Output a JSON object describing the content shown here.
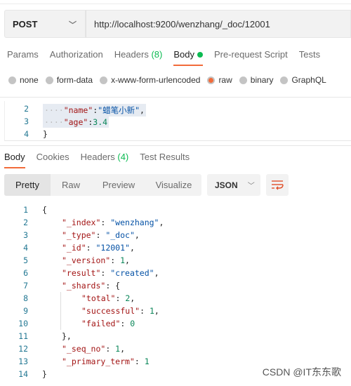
{
  "request": {
    "method": "POST",
    "url": "http://localhost:9200/wenzhang/_doc/12001"
  },
  "req_tabs": [
    {
      "label": "Params"
    },
    {
      "label": "Authorization"
    },
    {
      "label": "Headers",
      "count": "(8)"
    },
    {
      "label": "Body",
      "active": true
    },
    {
      "label": "Pre-request Script"
    },
    {
      "label": "Tests"
    }
  ],
  "body_types": [
    {
      "label": "none"
    },
    {
      "label": "form-data"
    },
    {
      "label": "x-www-form-urlencoded"
    },
    {
      "label": "raw",
      "selected": true
    },
    {
      "label": "binary"
    },
    {
      "label": "GraphQL"
    }
  ],
  "request_body_lines": [
    {
      "n": "2",
      "tokens": [
        [
          "ws",
          "····"
        ],
        [
          "k",
          "\"name\""
        ],
        [
          "p",
          ":"
        ],
        [
          "s",
          "\"蜡笔小新\""
        ],
        [
          "p",
          ","
        ]
      ]
    },
    {
      "n": "3",
      "tokens": [
        [
          "ws",
          "····"
        ],
        [
          "k",
          "\"age\""
        ],
        [
          "p",
          ":"
        ],
        [
          "n",
          "3.4"
        ]
      ]
    },
    {
      "n": "4",
      "tokens": [
        [
          "p",
          "}"
        ]
      ]
    }
  ],
  "resp_tabs": [
    {
      "label": "Body",
      "active": true
    },
    {
      "label": "Cookies"
    },
    {
      "label": "Headers",
      "count": "(4)"
    },
    {
      "label": "Test Results"
    }
  ],
  "view_modes": [
    {
      "label": "Pretty",
      "active": true
    },
    {
      "label": "Raw"
    },
    {
      "label": "Preview"
    },
    {
      "label": "Visualize"
    }
  ],
  "format": "JSON",
  "response_lines": [
    {
      "n": "1",
      "indent": 0,
      "tokens": [
        [
          "p",
          "{"
        ]
      ]
    },
    {
      "n": "2",
      "indent": 1,
      "tokens": [
        [
          "k",
          "\"_index\""
        ],
        [
          "p",
          ": "
        ],
        [
          "s",
          "\"wenzhang\""
        ],
        [
          "p",
          ","
        ]
      ]
    },
    {
      "n": "3",
      "indent": 1,
      "tokens": [
        [
          "k",
          "\"_type\""
        ],
        [
          "p",
          ": "
        ],
        [
          "s",
          "\"_doc\""
        ],
        [
          "p",
          ","
        ]
      ]
    },
    {
      "n": "4",
      "indent": 1,
      "tokens": [
        [
          "k",
          "\"_id\""
        ],
        [
          "p",
          ": "
        ],
        [
          "s",
          "\"12001\""
        ],
        [
          "p",
          ","
        ]
      ]
    },
    {
      "n": "5",
      "indent": 1,
      "tokens": [
        [
          "k",
          "\"_version\""
        ],
        [
          "p",
          ": "
        ],
        [
          "n",
          "1"
        ],
        [
          "p",
          ","
        ]
      ]
    },
    {
      "n": "6",
      "indent": 1,
      "tokens": [
        [
          "k",
          "\"result\""
        ],
        [
          "p",
          ": "
        ],
        [
          "s",
          "\"created\""
        ],
        [
          "p",
          ","
        ]
      ]
    },
    {
      "n": "7",
      "indent": 1,
      "tokens": [
        [
          "k",
          "\"_shards\""
        ],
        [
          "p",
          ": {"
        ]
      ]
    },
    {
      "n": "8",
      "indent": 2,
      "tokens": [
        [
          "k",
          "\"total\""
        ],
        [
          "p",
          ": "
        ],
        [
          "n",
          "2"
        ],
        [
          "p",
          ","
        ]
      ]
    },
    {
      "n": "9",
      "indent": 2,
      "tokens": [
        [
          "k",
          "\"successful\""
        ],
        [
          "p",
          ": "
        ],
        [
          "n",
          "1"
        ],
        [
          "p",
          ","
        ]
      ]
    },
    {
      "n": "10",
      "indent": 2,
      "tokens": [
        [
          "k",
          "\"failed\""
        ],
        [
          "p",
          ": "
        ],
        [
          "n",
          "0"
        ]
      ]
    },
    {
      "n": "11",
      "indent": 1,
      "tokens": [
        [
          "p",
          "},"
        ]
      ]
    },
    {
      "n": "12",
      "indent": 1,
      "tokens": [
        [
          "k",
          "\"_seq_no\""
        ],
        [
          "p",
          ": "
        ],
        [
          "n",
          "1"
        ],
        [
          "p",
          ","
        ]
      ]
    },
    {
      "n": "13",
      "indent": 1,
      "tokens": [
        [
          "k",
          "\"_primary_term\""
        ],
        [
          "p",
          ": "
        ],
        [
          "n",
          "1"
        ]
      ]
    },
    {
      "n": "14",
      "indent": 0,
      "tokens": [
        [
          "p",
          "}"
        ]
      ]
    }
  ],
  "watermark": "CSDN @IT东东歌",
  "colors": {
    "accent": "#f26b3a",
    "success": "#0cbb52",
    "json_key": "#a31515",
    "json_string": "#0451a5",
    "json_number": "#098658"
  }
}
